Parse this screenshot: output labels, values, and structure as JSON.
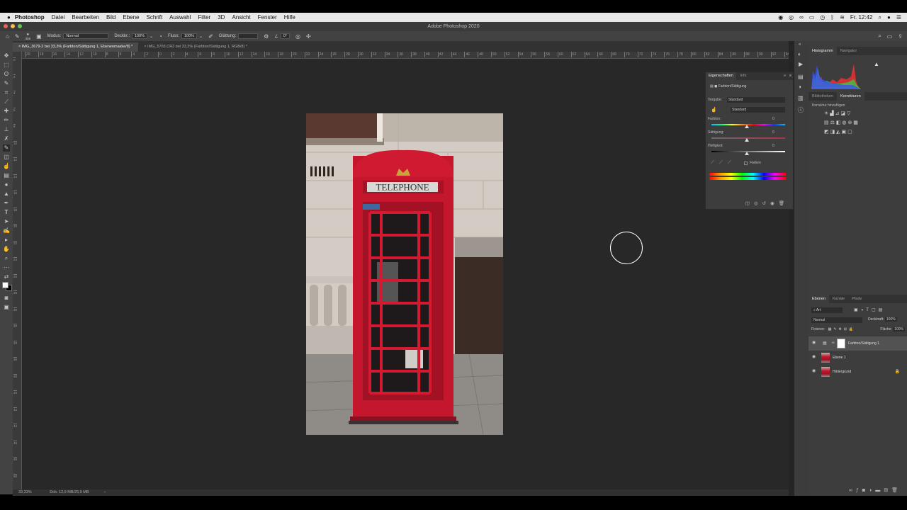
{
  "menubar": {
    "apple": "",
    "items": [
      "Photoshop",
      "Datei",
      "Bearbeiten",
      "Bild",
      "Ebene",
      "Schrift",
      "Auswahl",
      "Filter",
      "3D",
      "Ansicht",
      "Fenster",
      "Hilfe"
    ],
    "clock": "Fr. 12:42"
  },
  "window": {
    "title": "Adobe Photoshop 2020"
  },
  "options": {
    "brush_size": "356",
    "mode_label": "Modus:",
    "mode_value": "Normal",
    "opacity_label": "Deckkr.:",
    "opacity_value": "100%",
    "flow_label": "Fluss:",
    "flow_value": "100%",
    "smoothing_label": "Glättung:",
    "angle_value": "0°"
  },
  "tabs": [
    {
      "label": "IMG_3679-2 bei 33,3% (Farbton/Sättigung 1, Ebenenmaske/8) *"
    },
    {
      "label": "IMG_5765.CR2 bei 33,3% (Farbton/Sättigung 1, RGB/8) *"
    }
  ],
  "ruler_h_labels": [
    "20",
    "18",
    "16",
    "14",
    "12",
    "10",
    "8",
    "6",
    "4",
    "2",
    "0",
    "2",
    "4",
    "6",
    "8",
    "10",
    "12",
    "14",
    "16",
    "18",
    "20",
    "22",
    "24",
    "26",
    "28",
    "30",
    "32",
    "34",
    "36",
    "38",
    "40",
    "42",
    "44",
    "46",
    "48",
    "50",
    "52",
    "54",
    "56",
    "58",
    "60",
    "62",
    "64",
    "66",
    "68",
    "70",
    "72",
    "74",
    "76",
    "78",
    "80",
    "82",
    "84",
    "86",
    "88",
    "90",
    "92",
    "94"
  ],
  "ruler_v_labels": [
    "0",
    "2",
    "4",
    "6",
    "8",
    "10",
    "12",
    "14",
    "16",
    "18",
    "20",
    "22",
    "24",
    "26",
    "28",
    "30",
    "32",
    "34",
    "36",
    "38",
    "40",
    "42",
    "44",
    "46",
    "48",
    "50"
  ],
  "image": {
    "sign_text": "TELEPHONE"
  },
  "status": {
    "zoom": "33,33%",
    "doc": "Dok: 12,9 MB/25,9 MB"
  },
  "properties": {
    "tabs": [
      "Eigenschaften",
      "Info"
    ],
    "adjustment_name": "Farbton/Sättigung",
    "preset_label": "Vorgabe:",
    "preset_value": "Standard",
    "channel_value": "Standard",
    "hue_label": "Farbton:",
    "hue_value": "0",
    "saturation_label": "Sättigung:",
    "saturation_value": "0",
    "lightness_label": "Helligkeit:",
    "lightness_value": "0",
    "colorize_label": "Färben"
  },
  "histogram_tabs": [
    "Histogramm",
    "Navigator"
  ],
  "library_tabs": [
    "Bibliotheken",
    "Korrekturen"
  ],
  "corrections_label": "Korrektur hinzufügen",
  "layers_panel": {
    "tabs": [
      "Ebenen",
      "Kanäle",
      "Pfade"
    ],
    "filter_label": "Art",
    "blend_mode": "Normal",
    "opacity_label": "Deckkraft:",
    "opacity_value": "100%",
    "lock_label": "Fixieren:",
    "fill_label": "Fläche:",
    "fill_value": "100%",
    "layers": [
      {
        "name": "Farbton/Sättigung 1",
        "selected": true
      },
      {
        "name": "Ebene 1",
        "selected": false
      },
      {
        "name": "Hintergrund",
        "selected": false,
        "locked": true
      }
    ]
  }
}
